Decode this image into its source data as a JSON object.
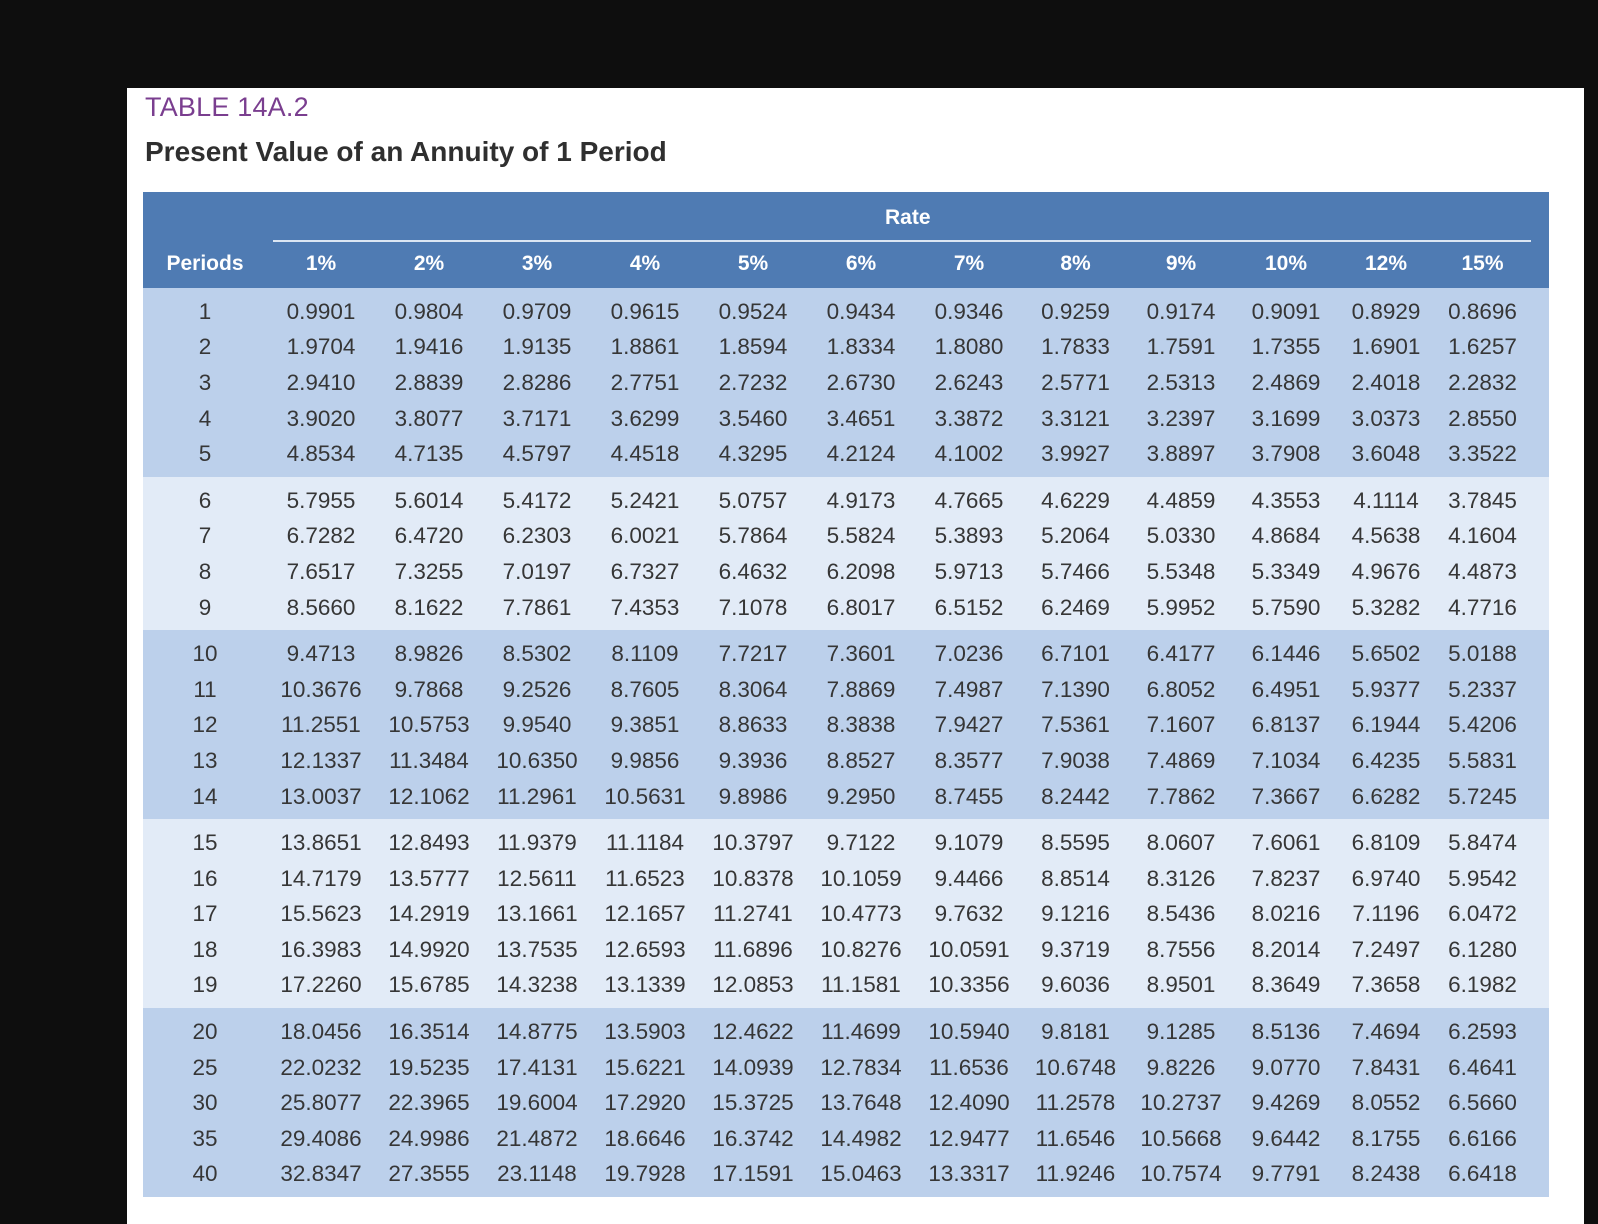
{
  "table": {
    "label": "TABLE 14A.2",
    "title": "Present Value of an Annuity of 1 Period",
    "rate_header": "Rate",
    "periods_header": "Periods",
    "rates": [
      "1%",
      "2%",
      "3%",
      "4%",
      "5%",
      "6%",
      "7%",
      "8%",
      "9%",
      "10%",
      "12%",
      "15%"
    ],
    "blocks": [
      {
        "shade": "dark",
        "rows": [
          {
            "period": "1",
            "values": [
              "0.9901",
              "0.9804",
              "0.9709",
              "0.9615",
              "0.9524",
              "0.9434",
              "0.9346",
              "0.9259",
              "0.9174",
              "0.9091",
              "0.8929",
              "0.8696"
            ]
          },
          {
            "period": "2",
            "values": [
              "1.9704",
              "1.9416",
              "1.9135",
              "1.8861",
              "1.8594",
              "1.8334",
              "1.8080",
              "1.7833",
              "1.7591",
              "1.7355",
              "1.6901",
              "1.6257"
            ]
          },
          {
            "period": "3",
            "values": [
              "2.9410",
              "2.8839",
              "2.8286",
              "2.7751",
              "2.7232",
              "2.6730",
              "2.6243",
              "2.5771",
              "2.5313",
              "2.4869",
              "2.4018",
              "2.2832"
            ]
          },
          {
            "period": "4",
            "values": [
              "3.9020",
              "3.8077",
              "3.7171",
              "3.6299",
              "3.5460",
              "3.4651",
              "3.3872",
              "3.3121",
              "3.2397",
              "3.1699",
              "3.0373",
              "2.8550"
            ]
          },
          {
            "period": "5",
            "values": [
              "4.8534",
              "4.7135",
              "4.5797",
              "4.4518",
              "4.3295",
              "4.2124",
              "4.1002",
              "3.9927",
              "3.8897",
              "3.7908",
              "3.6048",
              "3.3522"
            ]
          }
        ]
      },
      {
        "shade": "light",
        "rows": [
          {
            "period": "6",
            "values": [
              "5.7955",
              "5.6014",
              "5.4172",
              "5.2421",
              "5.0757",
              "4.9173",
              "4.7665",
              "4.6229",
              "4.4859",
              "4.3553",
              "4.1114",
              "3.7845"
            ]
          },
          {
            "period": "7",
            "values": [
              "6.7282",
              "6.4720",
              "6.2303",
              "6.0021",
              "5.7864",
              "5.5824",
              "5.3893",
              "5.2064",
              "5.0330",
              "4.8684",
              "4.5638",
              "4.1604"
            ]
          },
          {
            "period": "8",
            "values": [
              "7.6517",
              "7.3255",
              "7.0197",
              "6.7327",
              "6.4632",
              "6.2098",
              "5.9713",
              "5.7466",
              "5.5348",
              "5.3349",
              "4.9676",
              "4.4873"
            ]
          },
          {
            "period": "9",
            "values": [
              "8.5660",
              "8.1622",
              "7.7861",
              "7.4353",
              "7.1078",
              "6.8017",
              "6.5152",
              "6.2469",
              "5.9952",
              "5.7590",
              "5.3282",
              "4.7716"
            ]
          }
        ]
      },
      {
        "shade": "dark",
        "rows": [
          {
            "period": "10",
            "values": [
              "9.4713",
              "8.9826",
              "8.5302",
              "8.1109",
              "7.7217",
              "7.3601",
              "7.0236",
              "6.7101",
              "6.4177",
              "6.1446",
              "5.6502",
              "5.0188"
            ]
          },
          {
            "period": "11",
            "values": [
              "10.3676",
              "9.7868",
              "9.2526",
              "8.7605",
              "8.3064",
              "7.8869",
              "7.4987",
              "7.1390",
              "6.8052",
              "6.4951",
              "5.9377",
              "5.2337"
            ]
          },
          {
            "period": "12",
            "values": [
              "11.2551",
              "10.5753",
              "9.9540",
              "9.3851",
              "8.8633",
              "8.3838",
              "7.9427",
              "7.5361",
              "7.1607",
              "6.8137",
              "6.1944",
              "5.4206"
            ]
          },
          {
            "period": "13",
            "values": [
              "12.1337",
              "11.3484",
              "10.6350",
              "9.9856",
              "9.3936",
              "8.8527",
              "8.3577",
              "7.9038",
              "7.4869",
              "7.1034",
              "6.4235",
              "5.5831"
            ]
          },
          {
            "period": "14",
            "values": [
              "13.0037",
              "12.1062",
              "11.2961",
              "10.5631",
              "9.8986",
              "9.2950",
              "8.7455",
              "8.2442",
              "7.7862",
              "7.3667",
              "6.6282",
              "5.7245"
            ]
          }
        ]
      },
      {
        "shade": "light",
        "rows": [
          {
            "period": "15",
            "values": [
              "13.8651",
              "12.8493",
              "11.9379",
              "11.1184",
              "10.3797",
              "9.7122",
              "9.1079",
              "8.5595",
              "8.0607",
              "7.6061",
              "6.8109",
              "5.8474"
            ]
          },
          {
            "period": "16",
            "values": [
              "14.7179",
              "13.5777",
              "12.5611",
              "11.6523",
              "10.8378",
              "10.1059",
              "9.4466",
              "8.8514",
              "8.3126",
              "7.8237",
              "6.9740",
              "5.9542"
            ]
          },
          {
            "period": "17",
            "values": [
              "15.5623",
              "14.2919",
              "13.1661",
              "12.1657",
              "11.2741",
              "10.4773",
              "9.7632",
              "9.1216",
              "8.5436",
              "8.0216",
              "7.1196",
              "6.0472"
            ]
          },
          {
            "period": "18",
            "values": [
              "16.3983",
              "14.9920",
              "13.7535",
              "12.6593",
              "11.6896",
              "10.8276",
              "10.0591",
              "9.3719",
              "8.7556",
              "8.2014",
              "7.2497",
              "6.1280"
            ]
          },
          {
            "period": "19",
            "values": [
              "17.2260",
              "15.6785",
              "14.3238",
              "13.1339",
              "12.0853",
              "11.1581",
              "10.3356",
              "9.6036",
              "8.9501",
              "8.3649",
              "7.3658",
              "6.1982"
            ]
          }
        ]
      },
      {
        "shade": "dark",
        "rows": [
          {
            "period": "20",
            "values": [
              "18.0456",
              "16.3514",
              "14.8775",
              "13.5903",
              "12.4622",
              "11.4699",
              "10.5940",
              "9.8181",
              "9.1285",
              "8.5136",
              "7.4694",
              "6.2593"
            ]
          },
          {
            "period": "25",
            "values": [
              "22.0232",
              "19.5235",
              "17.4131",
              "15.6221",
              "14.0939",
              "12.7834",
              "11.6536",
              "10.6748",
              "9.8226",
              "9.0770",
              "7.8431",
              "6.4641"
            ]
          },
          {
            "period": "30",
            "values": [
              "25.8077",
              "22.3965",
              "19.6004",
              "17.2920",
              "15.3725",
              "13.7648",
              "12.4090",
              "11.2578",
              "10.2737",
              "9.4269",
              "8.0552",
              "6.5660"
            ]
          },
          {
            "period": "35",
            "values": [
              "29.4086",
              "24.9986",
              "21.4872",
              "18.6646",
              "16.3742",
              "14.4982",
              "12.9477",
              "11.6546",
              "10.5668",
              "9.6442",
              "8.1755",
              "6.6166"
            ]
          },
          {
            "period": "40",
            "values": [
              "32.8347",
              "27.3555",
              "23.1148",
              "19.7928",
              "17.1591",
              "15.0463",
              "13.3317",
              "11.9246",
              "10.7574",
              "9.7791",
              "8.2438",
              "6.6418"
            ]
          }
        ]
      }
    ]
  }
}
